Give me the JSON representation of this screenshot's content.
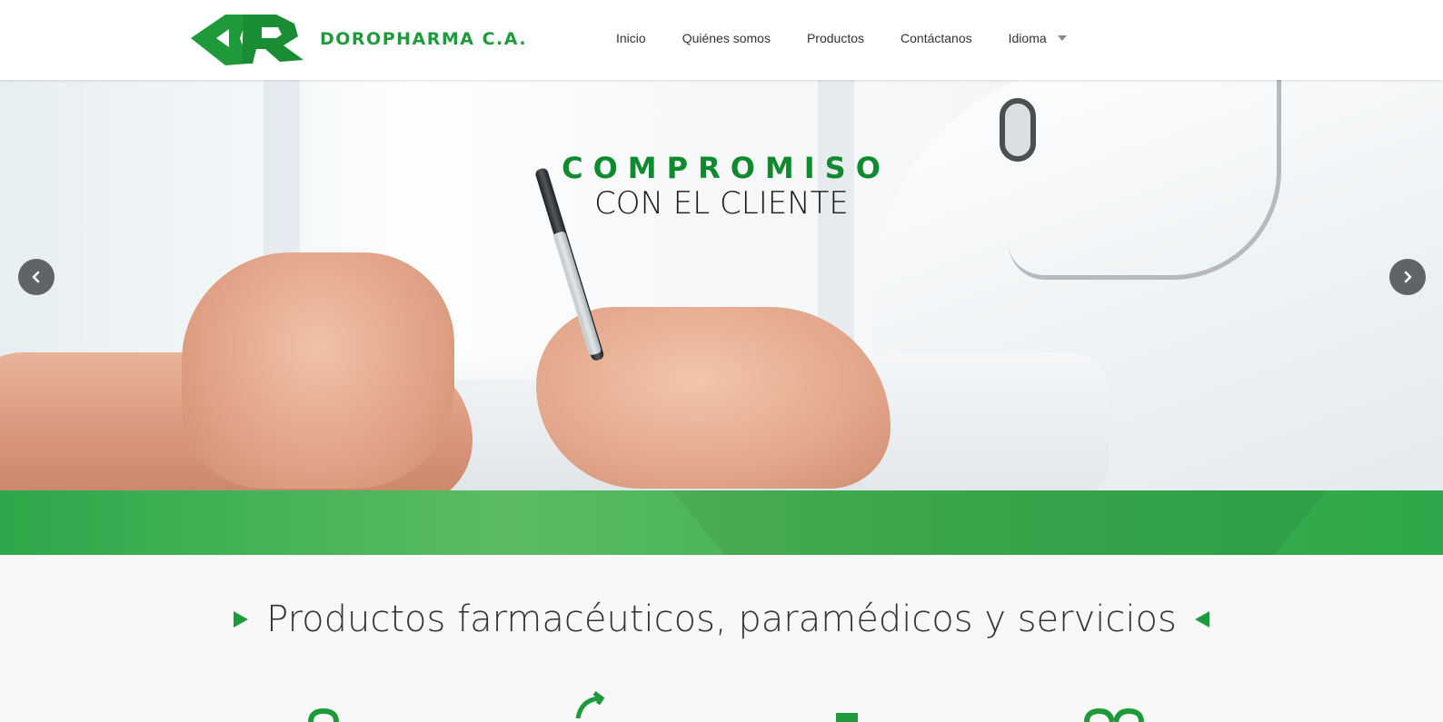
{
  "brand": {
    "name": "DOROPHARMA C.A.",
    "color": "#1e9a3a"
  },
  "nav": {
    "items": [
      {
        "label": "Inicio"
      },
      {
        "label": "Quiénes somos"
      },
      {
        "label": "Productos"
      },
      {
        "label": "Contáctanos"
      },
      {
        "label": "Idioma",
        "has_dropdown": true
      }
    ]
  },
  "hero": {
    "title_line1": "COMPROMISO",
    "title_line2": "CON EL CLIENTE",
    "accent_color": "#0f8a2e",
    "band_color": "#4cb85a",
    "prev_icon": "chevron-left-icon",
    "next_icon": "chevron-right-icon"
  },
  "section": {
    "title": "Productos farmacéuticos, paramédicos y servicios"
  }
}
